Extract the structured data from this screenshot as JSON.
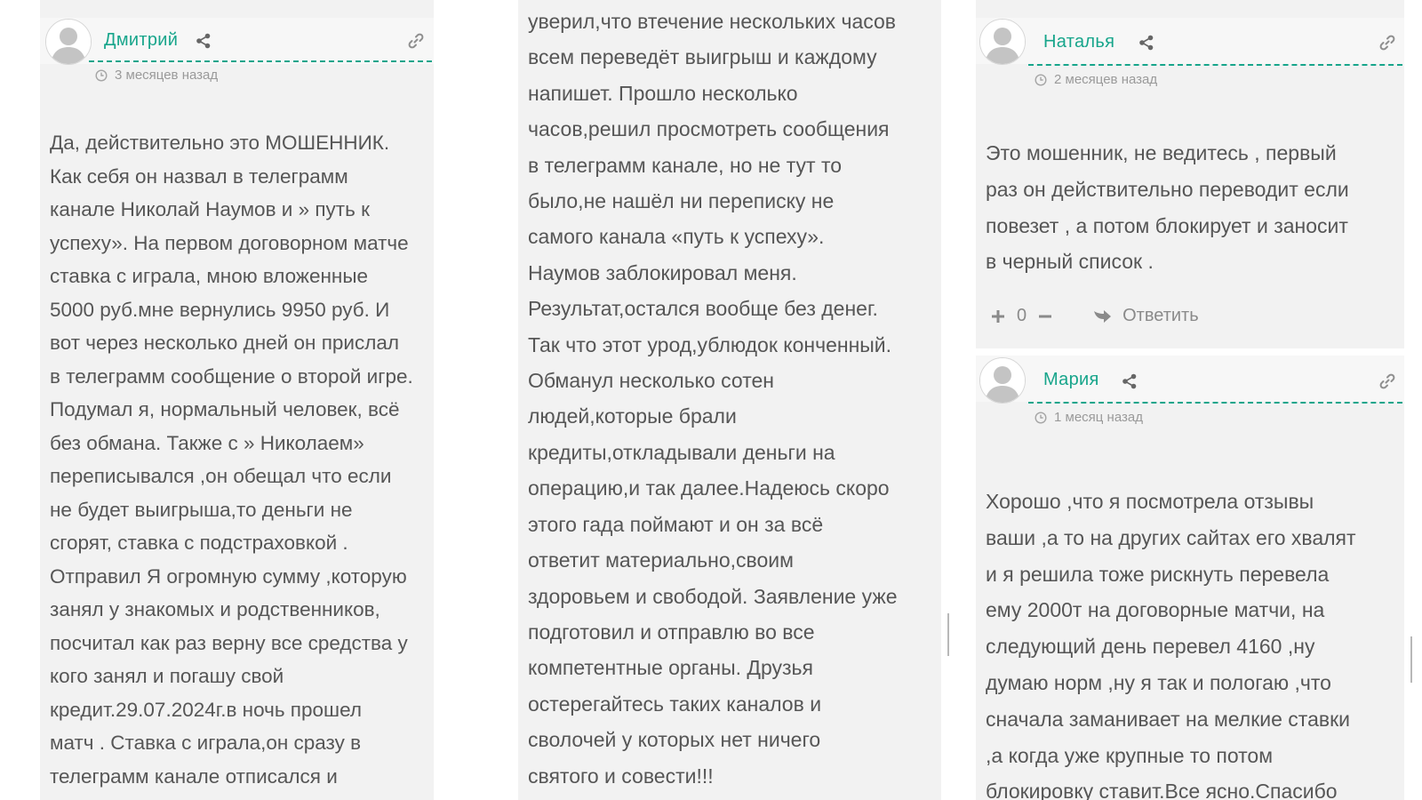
{
  "comments_left": {
    "author": "Дмитрий",
    "time": "3 месяцев назад",
    "text": "Да, действительно это МОШЕННИК.\nКак себя он назвал в телеграмм\nканале Николай Наумов и » путь к\nуспеху». На первом договорном матче\nставка с играла, мною вложенные\n5000 руб.мне вернулись 9950 руб. И\nвот через несколько дней он прислал\nв телеграмм сообщение о второй игре.\nПодумал я, нормальный человек, всё\nбез обмана. Также с » Николаем»\nпереписывался ,он обещал что если\nне будет выигрыша,то деньги не\nсгорят, ставка с подстраховкой .\nОтправил Я огромную сумму ,которую\nзанял у знакомых и родственников,\nпосчитал как раз верну все средства у\nкого занял и погашу свой\nкредит.29.07.2024г.в ночь прошел\nматч . Ставка с играла,он сразу в\nтелеграмм канале отписался и"
  },
  "comments_mid": {
    "text": "уверил,что втечение нескольких часов\nвсем переведёт выигрыш и каждому\nнапишет. Прошло несколько\nчасов,решил просмотреть сообщения\nв телеграмм канале, но не тут то\nбыло,не нашёл ни переписку не\nсамого канала «путь к успеху».\nНаумов заблокировал меня.\nРезультат,остался вообще без денег.\nТак что этот урод,ублюдок конченный.\nОбманул несколько сотен\nлюдей,которые брали\nкредиты,откладывали деньги на\nоперацию,и так далее.Надеюсь скоро\nэтого гада поймают и он за всё\nответит материально,своим\nздоровьем и свободой. Заявление уже\nподготовил и отправлю во все\nкомпетентные органы. Друзья\nостерегайтесь таких каналов и\nсволочей у которых нет ничего\nсвятого и совести!!!"
  },
  "comments_right": [
    {
      "author": "Наталья",
      "time": "2 месяцев назад",
      "text": "Это мошенник, не ведитесь , первый\nраз он действительно переводит если\nповезет , а потом блокирует и заносит\nв черный список .",
      "votes": "0",
      "reply_label": "Ответить"
    },
    {
      "author": "Мария",
      "time": "1 месяц назад",
      "text": "Хорошо ,что я посмотрела отзывы\nваши ,а то на других сайтах его хвалят\nи я решила тоже рискнуть перевела\nему 2000т на договорные матчи, на\nследующий день перевел 4160 ,ну\nдумаю норм ,ну я так и пологаю ,что\nсначала заманивает на мелкие ставки\n,а когда уже крупные то потом\nблокировку ставит.Все ясно.Спасибо"
    }
  ],
  "colors": {
    "accent": "#17a58b",
    "text": "#565656",
    "muted": "#9a9a9a",
    "panel": "#f2f2f2"
  },
  "icons": [
    "avatar-placeholder",
    "share-icon",
    "link-icon",
    "clock-icon",
    "plus-icon",
    "minus-icon",
    "reply-arrow-icon"
  ]
}
